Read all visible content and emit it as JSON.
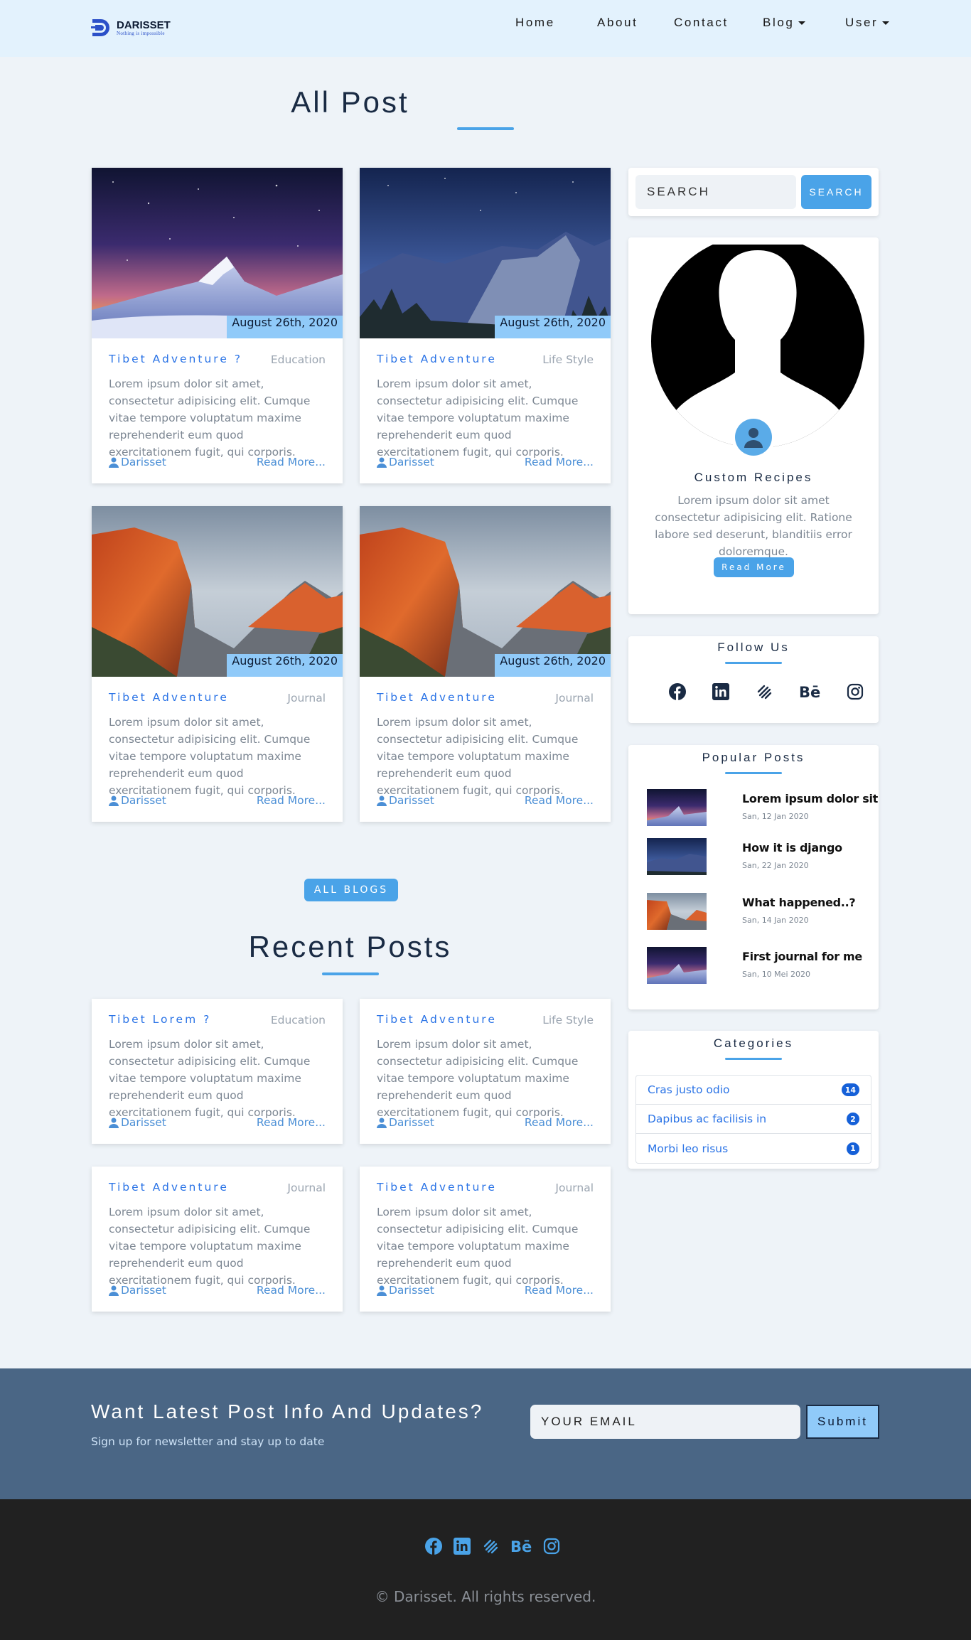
{
  "brand": {
    "name": "DARISSET",
    "tagline": "Nothing is impossible"
  },
  "nav": {
    "home": "Home",
    "about": "About",
    "contact": "Contact",
    "blog": "Blog",
    "user": "User"
  },
  "all_post": {
    "title": "All Post",
    "posts": [
      {
        "title": "Tibet Adventure ?",
        "category": "Education",
        "date": "August 26th, 2020",
        "excerpt": "Lorem ipsum dolor sit amet, consectetur adipisicing elit. Cumque vitae tempore voluptatum maxime reprehenderit eum quod exercitationem fugit, qui corporis.",
        "author": "Darisset",
        "read_more": "Read More..."
      },
      {
        "title": "Tibet Adventure",
        "category": "Life Style",
        "date": "August 26th, 2020",
        "excerpt": "Lorem ipsum dolor sit amet, consectetur adipisicing elit. Cumque vitae tempore voluptatum maxime reprehenderit eum quod exercitationem fugit, qui corporis.",
        "author": "Darisset",
        "read_more": "Read More..."
      },
      {
        "title": "Tibet Adventure",
        "category": "Journal",
        "date": "August 26th, 2020",
        "excerpt": "Lorem ipsum dolor sit amet, consectetur adipisicing elit. Cumque vitae tempore voluptatum maxime reprehenderit eum quod exercitationem fugit, qui corporis.",
        "author": "Darisset",
        "read_more": "Read More..."
      },
      {
        "title": "Tibet Adventure",
        "category": "Journal",
        "date": "August 26th, 2020",
        "excerpt": "Lorem ipsum dolor sit amet, consectetur adipisicing elit. Cumque vitae tempore voluptatum maxime reprehenderit eum quod exercitationem fugit, qui corporis.",
        "author": "Darisset",
        "read_more": "Read More..."
      }
    ]
  },
  "all_blogs_button": "ALL BLOGS",
  "recent_posts": {
    "title": "Recent Posts",
    "posts": [
      {
        "title": "Tibet Lorem ?",
        "category": "Education",
        "excerpt": "Lorem ipsum dolor sit amet, consectetur adipisicing elit. Cumque vitae tempore voluptatum maxime reprehenderit eum quod exercitationem fugit, qui corporis.",
        "author": "Darisset",
        "read_more": "Read More..."
      },
      {
        "title": "Tibet Adventure",
        "category": "Life Style",
        "excerpt": "Lorem ipsum dolor sit amet, consectetur adipisicing elit. Cumque vitae tempore voluptatum maxime reprehenderit eum quod exercitationem fugit, qui corporis.",
        "author": "Darisset",
        "read_more": "Read More..."
      },
      {
        "title": "Tibet Adventure",
        "category": "Journal",
        "excerpt": "Lorem ipsum dolor sit amet, consectetur adipisicing elit. Cumque vitae tempore voluptatum maxime reprehenderit eum quod exercitationem fugit, qui corporis.",
        "author": "Darisset",
        "read_more": "Read More..."
      },
      {
        "title": "Tibet Adventure",
        "category": "Journal",
        "excerpt": "Lorem ipsum dolor sit amet, consectetur adipisicing elit. Cumque vitae tempore voluptatum maxime reprehenderit eum quod exercitationem fugit, qui corporis.",
        "author": "Darisset",
        "read_more": "Read More..."
      }
    ]
  },
  "sidebar": {
    "search": {
      "placeholder": "SEARCH",
      "button": "SEARCH"
    },
    "profile": {
      "name": "Custom Recipes",
      "bio": "Lorem ipsum dolor sit amet consectetur adipisicing elit. Ratione labore sed deserunt, blanditiis error doloremque.",
      "button": "Read More"
    },
    "follow": {
      "title": "Follow Us",
      "icons": [
        "facebook-icon",
        "linkedin-icon",
        "stackshare-icon",
        "behance-icon",
        "instagram-icon"
      ]
    },
    "popular": {
      "title": "Popular Posts",
      "items": [
        {
          "title": "Lorem ipsum dolor sit",
          "date": "San, 12 Jan 2020"
        },
        {
          "title": "How it is django",
          "date": "San, 22 Jan 2020"
        },
        {
          "title": "What happened..?",
          "date": "San, 14 Jan 2020"
        },
        {
          "title": "First journal for me",
          "date": "San, 10 Mei 2020"
        }
      ]
    },
    "categories": {
      "title": "Categories",
      "items": [
        {
          "name": "Cras justo odio",
          "count": "14"
        },
        {
          "name": "Dapibus ac facilisis in",
          "count": "2"
        },
        {
          "name": "Morbi leo risus",
          "count": "1"
        }
      ]
    }
  },
  "newsletter": {
    "title": "Want Latest Post Info And Updates?",
    "subtitle": "Sign up for newsletter and stay up to date",
    "placeholder": "YOUR EMAIL",
    "button": "Submit"
  },
  "footer": {
    "copyright": "© Darisset. All rights reserved.",
    "icons": [
      "facebook-icon",
      "linkedin-icon",
      "stackshare-icon",
      "behance-icon",
      "instagram-icon"
    ]
  },
  "colors": {
    "accent": "#4aa3e8",
    "link": "#2a73e6",
    "header_bg": "#e3f2fd",
    "page_bg": "#eef3f8",
    "newsletter_bg": "#4a6685",
    "footer_bg": "#212121",
    "date_badge": "#90caf9"
  }
}
